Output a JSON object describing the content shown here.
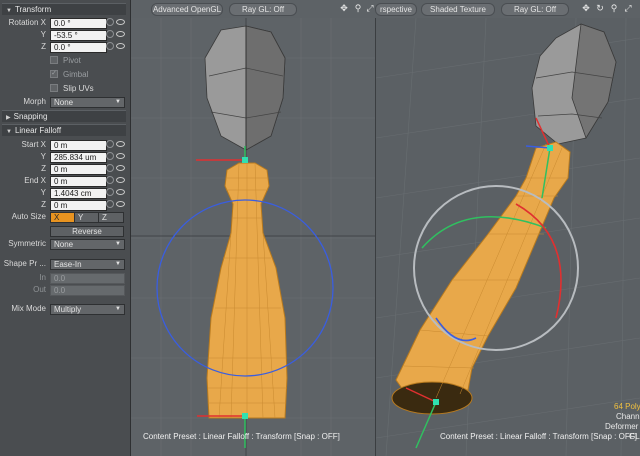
{
  "panel": {
    "transform_title": "Transform",
    "rotation": {
      "label_x": "Rotation X",
      "label_y": "Y",
      "label_z": "Z",
      "x": "0.0 °",
      "y": "-53.5 °",
      "z": "0.0 °"
    },
    "pivot_label": "Pivot",
    "gimbal_label": "Gimbal",
    "slip_uvs_label": "Slip UVs",
    "morph_label": "Morph",
    "morph_value": "None",
    "snapping_title": "Snapping",
    "linear_falloff_title": "Linear Falloff",
    "start": {
      "label_x": "Start X",
      "label_y": "Y",
      "label_z": "Z",
      "x": "0 m",
      "y": "285.834 um",
      "z": "0 m"
    },
    "end": {
      "label_x": "End X",
      "label_y": "Y",
      "label_z": "Z",
      "x": "0 m",
      "y": "1.4043 cm",
      "z": "0 m"
    },
    "auto_size_label": "Auto Size",
    "auto_size_x": "X",
    "auto_size_y": "Y",
    "auto_size_z": "Z",
    "reverse_label": "Reverse",
    "symmetric_label": "Symmetric",
    "symmetric_value": "None",
    "shape_preset_label": "Shape Pr ...",
    "shape_preset_value": "Ease-In",
    "in_label": "In",
    "in_value": "0.0",
    "out_label": "Out",
    "out_value": "0.0",
    "mix_mode_label": "Mix Mode",
    "mix_mode_value": "Multiply"
  },
  "toolbar": {
    "advanced_opengl": "Advanced OpenGL",
    "ray_gl_1": "Ray GL: Off",
    "perspective": "rspective",
    "shaded_texture": "Shaded Texture",
    "ray_gl_2": "Ray GL: Off"
  },
  "viewport_right_info": {
    "polys": "64 Poly",
    "channels": "Chann",
    "deformers": "Deformer",
    "gl": "GL"
  },
  "status": {
    "text": "Content Preset : Linear Falloff : Transform  [Snap : OFF]",
    "text_right": "Content Preset : Linear Falloff : Transform  [Snap : OFF]"
  },
  "colors": {
    "accent": "#e89320",
    "mesh": "#e8a84a",
    "handle_red": "#e03030",
    "handle_green": "#30c060",
    "handle_blue": "#3a5ee0"
  }
}
